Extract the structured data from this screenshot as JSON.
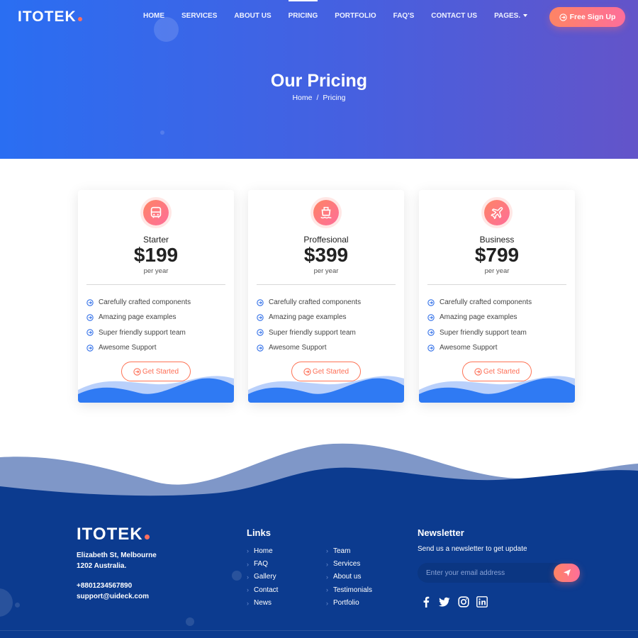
{
  "brand": {
    "name": "ITOTEK",
    "accent": "#fe6f5e",
    "primary": "#2a6ef2",
    "footer_bg": "#0c3b8f"
  },
  "nav": {
    "items": [
      {
        "label": "HOME"
      },
      {
        "label": "SERVICES"
      },
      {
        "label": "ABOUT US"
      },
      {
        "label": "PRICING",
        "active": true
      },
      {
        "label": "PORTFOLIO"
      },
      {
        "label": "FAQ'S"
      },
      {
        "label": "CONTACT US"
      },
      {
        "label": "PAGES."
      }
    ],
    "cta": {
      "label": "Free Sign Up",
      "icon": "arrow-circle-right-icon"
    }
  },
  "hero": {
    "title": "Our Pricing",
    "breadcrumb": {
      "home": "Home",
      "separator": "/",
      "current": "Pricing"
    }
  },
  "pricing": [
    {
      "icon": "bus-icon",
      "name": "Starter",
      "price": "$199",
      "period": "per year",
      "features": [
        "Carefully crafted components",
        "Amazing page examples",
        "Super friendly support team",
        "Awesome Support"
      ],
      "button": "Get Started"
    },
    {
      "icon": "ship-icon",
      "name": "Proffesional",
      "price": "$399",
      "period": "per year",
      "features": [
        "Carefully crafted components",
        "Amazing page examples",
        "Super friendly support team",
        "Awesome Support"
      ],
      "button": "Get Started"
    },
    {
      "icon": "airplane-icon",
      "name": "Business",
      "price": "$799",
      "period": "per year",
      "features": [
        "Carefully crafted components",
        "Amazing page examples",
        "Super friendly support team",
        "Awesome Support"
      ],
      "button": "Get Started"
    }
  ],
  "footer": {
    "logo": "ITOTEK",
    "address_line1": "Elizabeth St, Melbourne",
    "address_line2": "1202 Australia.",
    "phone": "+8801234567890",
    "email": "support@uideck.com",
    "links_title": "Links",
    "links_col1": [
      "Home",
      "FAQ",
      "Gallery",
      "Contact",
      "News"
    ],
    "links_col2": [
      "Team",
      "Services",
      "About us",
      "Testimonials",
      "Portfolio"
    ],
    "newsletter_title": "Newsletter",
    "newsletter_text": "Send us a newsletter to get update",
    "newsletter_placeholder": "Enter your email address",
    "social": [
      "facebook-icon",
      "twitter-icon",
      "instagram-icon",
      "linkedin-icon"
    ]
  }
}
